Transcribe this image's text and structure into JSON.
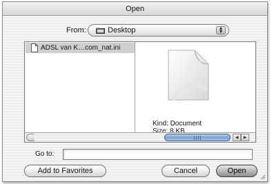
{
  "window": {
    "title": "Open"
  },
  "from": {
    "label": "From:",
    "value": "Desktop",
    "icon": "folder-icon"
  },
  "browser": {
    "files": [
      {
        "name": "ADSL van K…com_nat.ini",
        "icon": "document-icon",
        "selected": true
      }
    ],
    "preview": {
      "icon": "generic-document-icon",
      "kind": "Kind: Document",
      "size": "Size: 8 KB"
    }
  },
  "goto": {
    "label": "Go to:",
    "value": ""
  },
  "buttons": {
    "add_favorites": "Add to Favorites",
    "cancel": "Cancel",
    "open": "Open"
  },
  "colors": {
    "selection": "#cfcfcf",
    "scroll_thumb": "#7fa2d2"
  }
}
